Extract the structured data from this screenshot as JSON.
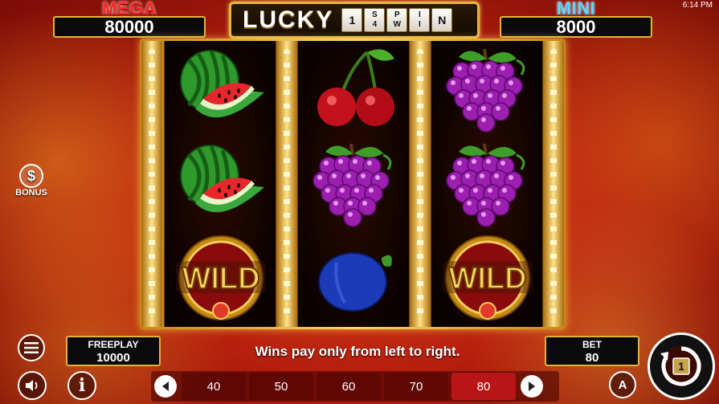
{
  "status_bar": {
    "time": "6:14 PM"
  },
  "jackpots": {
    "mega": {
      "label": "MEGA",
      "value": "80000"
    },
    "mini": {
      "label": "MINI",
      "value": "8000"
    }
  },
  "logo": {
    "word": "LUCKY",
    "tiles": [
      {
        "top": "",
        "mid": "1",
        "bot": ""
      },
      {
        "top": "S",
        "mid": "",
        "bot": "4"
      },
      {
        "top": "P",
        "mid": "",
        "bot": "W"
      },
      {
        "top": "I",
        "mid": "",
        "bot": "I"
      },
      {
        "top": "",
        "mid": "N",
        "bot": ""
      }
    ]
  },
  "reels": [
    [
      "watermelon",
      "watermelon",
      "wild"
    ],
    [
      "cherries",
      "grapes",
      "plum"
    ],
    [
      "grapes",
      "grapes",
      "wild"
    ]
  ],
  "wild_label": "WILD",
  "bonus_button": {
    "label": "BONUS"
  },
  "freeplay": {
    "label": "FREEPLAY",
    "value": "10000"
  },
  "bet": {
    "label": "BET",
    "value": "80"
  },
  "message": "Wins pay only from left to right.",
  "bet_options": [
    "40",
    "50",
    "60",
    "70",
    "80"
  ],
  "selected_bet": "80",
  "auto_button": {
    "label": "A"
  },
  "icons": {
    "menu": "menu-icon",
    "sound": "speaker-icon",
    "info": "info-icon",
    "prev": "chevron-left-icon",
    "next": "chevron-right-icon",
    "spin": "spin-icon"
  },
  "colors": {
    "frame_gold": "#e3b23c",
    "selected_bet": "#b81616",
    "mega": "#ff2a2a",
    "mini": "#5fd6ff"
  }
}
